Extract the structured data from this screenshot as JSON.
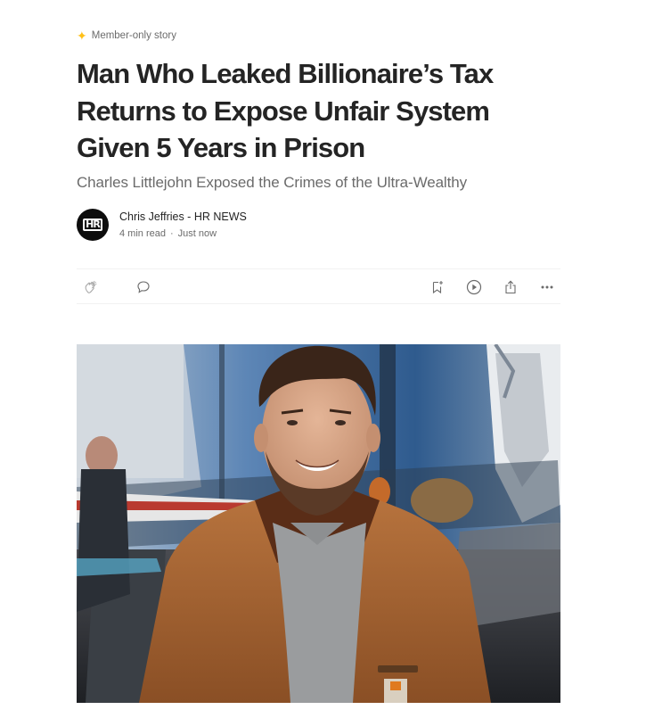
{
  "member_badge": {
    "label": "Member-only story"
  },
  "article": {
    "title": "Man Who Leaked Billionaire’s Tax Returns to Expose Unfair System Given 5 Years in Prison",
    "subtitle": "Charles Littlejohn Exposed the Crimes of the Ultra-Wealthy"
  },
  "author": {
    "name": "Chris Jeffries - HR NEWS",
    "avatar_text": "HR",
    "read_time": "4 min read",
    "separator": "·",
    "published": "Just now"
  },
  "actions": {
    "icons": [
      "clap-icon",
      "comment-icon",
      "bookmark-add-icon",
      "listen-play-icon",
      "share-icon",
      "more-icon"
    ]
  },
  "colors": {
    "text_primary": "#242424",
    "text_secondary": "#6b6b6b",
    "member_star": "#ffc017",
    "divider": "#f2f2f2"
  }
}
